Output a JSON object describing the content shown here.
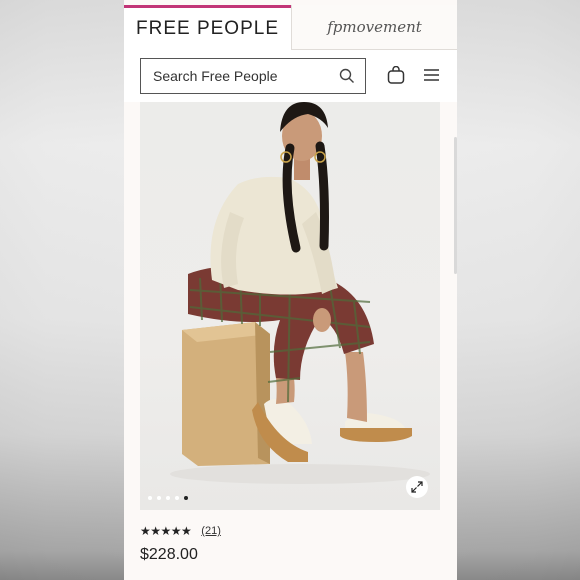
{
  "brand_tabs": {
    "primary": "FREE PEOPLE",
    "secondary": "fpmovement"
  },
  "search": {
    "placeholder": "Search Free People"
  },
  "icons": {
    "search": "search-icon",
    "bag": "shopping-bag-icon",
    "menu": "hamburger-menu-icon",
    "expand": "expand-icon",
    "star": "star-icon"
  },
  "product": {
    "image_alt": "Model in cream sweater, plaid pants and white platform clogs sitting on a wooden block",
    "carousel": {
      "total": 5,
      "active_index": 4
    },
    "rating": {
      "stars": "★★★★★",
      "count": "(21)"
    },
    "price": "$228.00"
  },
  "colors": {
    "accent": "#c23577",
    "text": "#222222",
    "background": "#fcf9f7"
  }
}
